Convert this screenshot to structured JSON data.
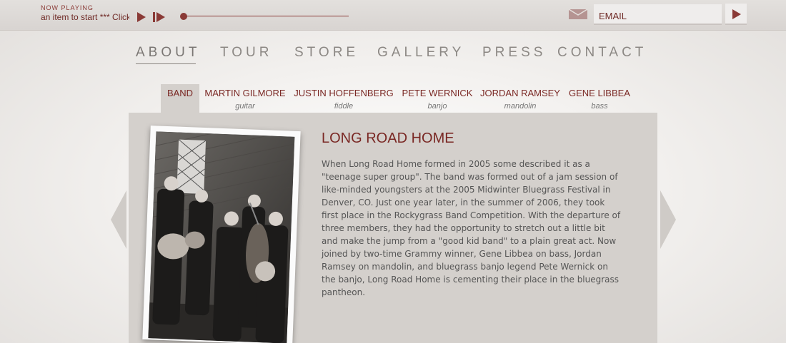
{
  "player": {
    "now_playing_label": "NOW PLAYING",
    "track_text": "an item to start *** Click",
    "progress": 0.0,
    "play_icon": "play-icon",
    "next_icon": "skip-next-icon"
  },
  "newsletter": {
    "icon": "envelope-icon",
    "placeholder": "EMAIL",
    "submit_icon": "arrow-right-icon"
  },
  "nav": {
    "items": [
      {
        "label": "ABOUT",
        "active": true
      },
      {
        "label": "TOUR"
      },
      {
        "label": "STORE"
      },
      {
        "label": "GALLERY"
      },
      {
        "label": "PRESS"
      },
      {
        "label": "CONTACT"
      }
    ]
  },
  "subnav": {
    "items": [
      {
        "label": "BAND",
        "role": "",
        "active": true
      },
      {
        "label": "MARTIN GILMORE",
        "role": "guitar"
      },
      {
        "label": "JUSTIN HOFFENBERG",
        "role": "fiddle"
      },
      {
        "label": "PETE WERNICK",
        "role": "banjo"
      },
      {
        "label": "JORDAN RAMSEY",
        "role": "mandolin"
      },
      {
        "label": "GENE LIBBEA",
        "role": "bass"
      }
    ]
  },
  "content": {
    "title": "LONG ROAD HOME",
    "bio": "When Long Road Home formed in 2005 some described it as a \"teenage super group\". The band was formed out of a jam session of like-minded youngsters at the 2005 Midwinter Bluegrass Festival in Denver, CO. Just one year later, in the summer of 2006, they took first place in the Rockygrass Band Competition. With the departure of three members, they had the opportunity to stretch out a little bit and make the jump from a \"good kid band\" to a plain great act. Now joined by two-time Grammy winner, Gene Libbea on bass, Jordan Ramsey on mandolin, and bluegrass banjo legend Pete Wernick on the banjo, Long Road Home is cementing their place in the bluegrass pantheon."
  },
  "colors": {
    "accent": "#7a2824",
    "panel": "#d4d0cc",
    "nav_text": "#8c8884"
  }
}
